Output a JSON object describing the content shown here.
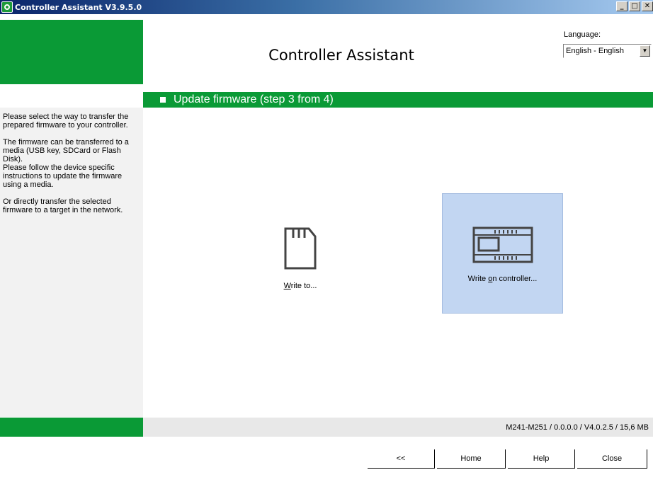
{
  "window": {
    "title": "Controller Assistant V3.9.5.0",
    "minimize": "_",
    "maximize": "□",
    "close": "✕"
  },
  "header": {
    "title": "Controller Assistant",
    "language_label": "Language:",
    "language_value": "English - English",
    "language_arrow": "▼"
  },
  "step": {
    "title": "Update firmware (step 3 from 4)"
  },
  "left_panel": {
    "paragraphs": [
      "Please select the way to transfer the prepared firmware to your controller.",
      "The firmware can be transferred to a media (USB key, SDCard or Flash Disk).\nPlease follow the device specific instructions to update the firmware using a media.",
      "Or directly transfer the selected firmware to a target in the network."
    ]
  },
  "options": {
    "write_to": {
      "mnemonic": "W",
      "rest": "rite to...",
      "icon": "sd-card-icon"
    },
    "write_controller": {
      "prefix": "Write ",
      "mnemonic": "o",
      "rest": "n controller...",
      "icon": "controller-icon",
      "selected": true
    }
  },
  "status": {
    "text": "M241-M251 / 0.0.0.0 / V4.0.2.5 / 15,6 MB"
  },
  "buttons": {
    "back": "<<",
    "home": "Home",
    "help": "Help",
    "close": "Close"
  },
  "colors": {
    "brand_green": "#0a9a36",
    "selected_bg": "#c2d6f2"
  }
}
